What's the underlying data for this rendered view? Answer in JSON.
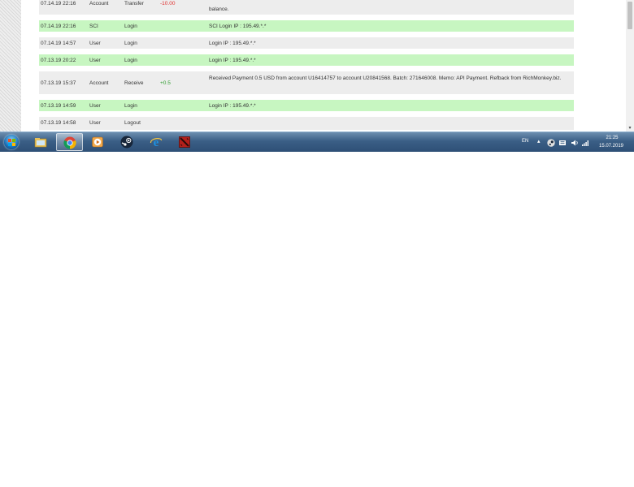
{
  "history": {
    "rows": [
      {
        "date": "07.14.19 22:16",
        "type": "Account",
        "action": "Transfer",
        "amount": "-10.00",
        "amount_sign": "neg",
        "description": "balance.",
        "style": "gray"
      },
      {
        "date": "07.14.19 22:16",
        "type": "SCI",
        "action": "Login",
        "amount": "",
        "amount_sign": "",
        "description": "SCI Login IP : 195.49.*.*",
        "style": "green"
      },
      {
        "date": "07.14.19 14:57",
        "type": "User",
        "action": "Login",
        "amount": "",
        "amount_sign": "",
        "description": "Login IP : 195.49.*.*",
        "style": "gray"
      },
      {
        "date": "07.13.19 20:22",
        "type": "User",
        "action": "Login",
        "amount": "",
        "amount_sign": "",
        "description": "Login IP : 195.49.*.*",
        "style": "green"
      },
      {
        "date": "07.13.19 15:37",
        "type": "Account",
        "action": "Receive",
        "amount": "+0.5",
        "amount_sign": "pos",
        "description": "Received Payment 0.5 USD from account U16414757 to account U20841568. Batch: 271646008. Memo: API Payment. Refback from RichMonkey.biz.",
        "style": "gray"
      },
      {
        "date": "07.13.19 14:59",
        "type": "User",
        "action": "Login",
        "amount": "",
        "amount_sign": "",
        "description": "Login IP : 195.49.*.*",
        "style": "green"
      },
      {
        "date": "07.13.19 14:58",
        "type": "User",
        "action": "Logout",
        "amount": "",
        "amount_sign": "",
        "description": "",
        "style": "gray"
      }
    ]
  },
  "taskbar": {
    "apps": [
      "explorer-icon",
      "chrome-icon",
      "media-player-icon",
      "steam-icon",
      "internet-explorer-icon",
      "dota2-icon"
    ],
    "active_app": "chrome-icon",
    "language": "EN",
    "time": "21:25",
    "date": "15.07.2019"
  },
  "colors": {
    "row_green": "#c7f6c1",
    "row_gray": "#ededed",
    "negative": "#e0312f",
    "positive": "#2e9c2e"
  }
}
